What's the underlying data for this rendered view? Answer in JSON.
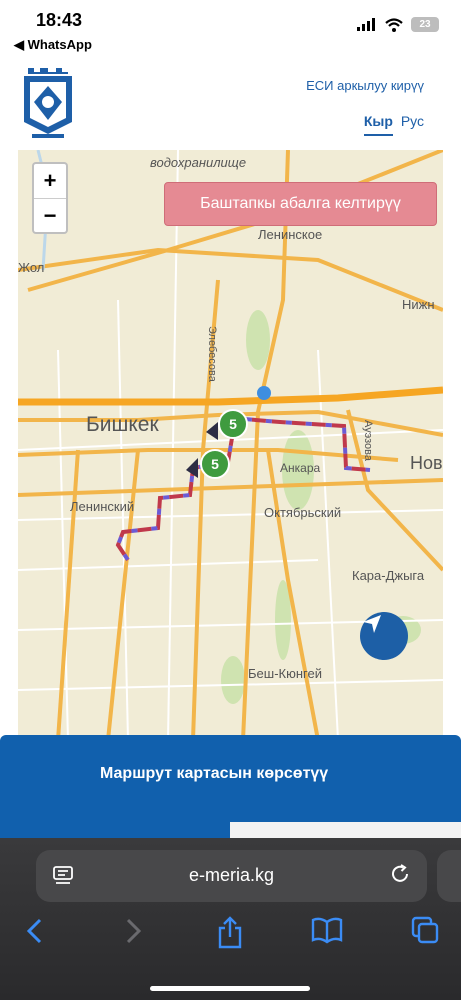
{
  "status": {
    "time": "18:43",
    "back_app": "◀ WhatsApp",
    "battery": "23"
  },
  "header": {
    "esi_login": "ЕСИ аркылуу кирүү",
    "lang_active": "Кыр",
    "lang_other": "Рус"
  },
  "map": {
    "zoom_in": "+",
    "zoom_out": "−",
    "reset_button": "Баштапкы абалга келтирүү",
    "labels": {
      "reservoir": "водохранилище",
      "leninskoe": "Ленинское",
      "zhol": "Жол",
      "nizh": "Нижн",
      "elebesova": "Элебесова",
      "bishkek": "Бишкек",
      "auezova": "Ауэзова",
      "novo": "Нов",
      "ankara": "Анкара",
      "leninsky": "Ленинский",
      "oktyabrsky": "Октябрьский",
      "kara_dzhygach": "Кара-Джыга",
      "besh_kungey": "Беш-Кюнгей"
    },
    "route_badge_1": "5",
    "route_badge_2": "5",
    "route_color_1": "#c0394b",
    "route_color_2": "#6b5bd6"
  },
  "banner": {
    "title": "Маршрут картасын көрсөтүү"
  },
  "browser": {
    "url": "e-meria.kg"
  }
}
